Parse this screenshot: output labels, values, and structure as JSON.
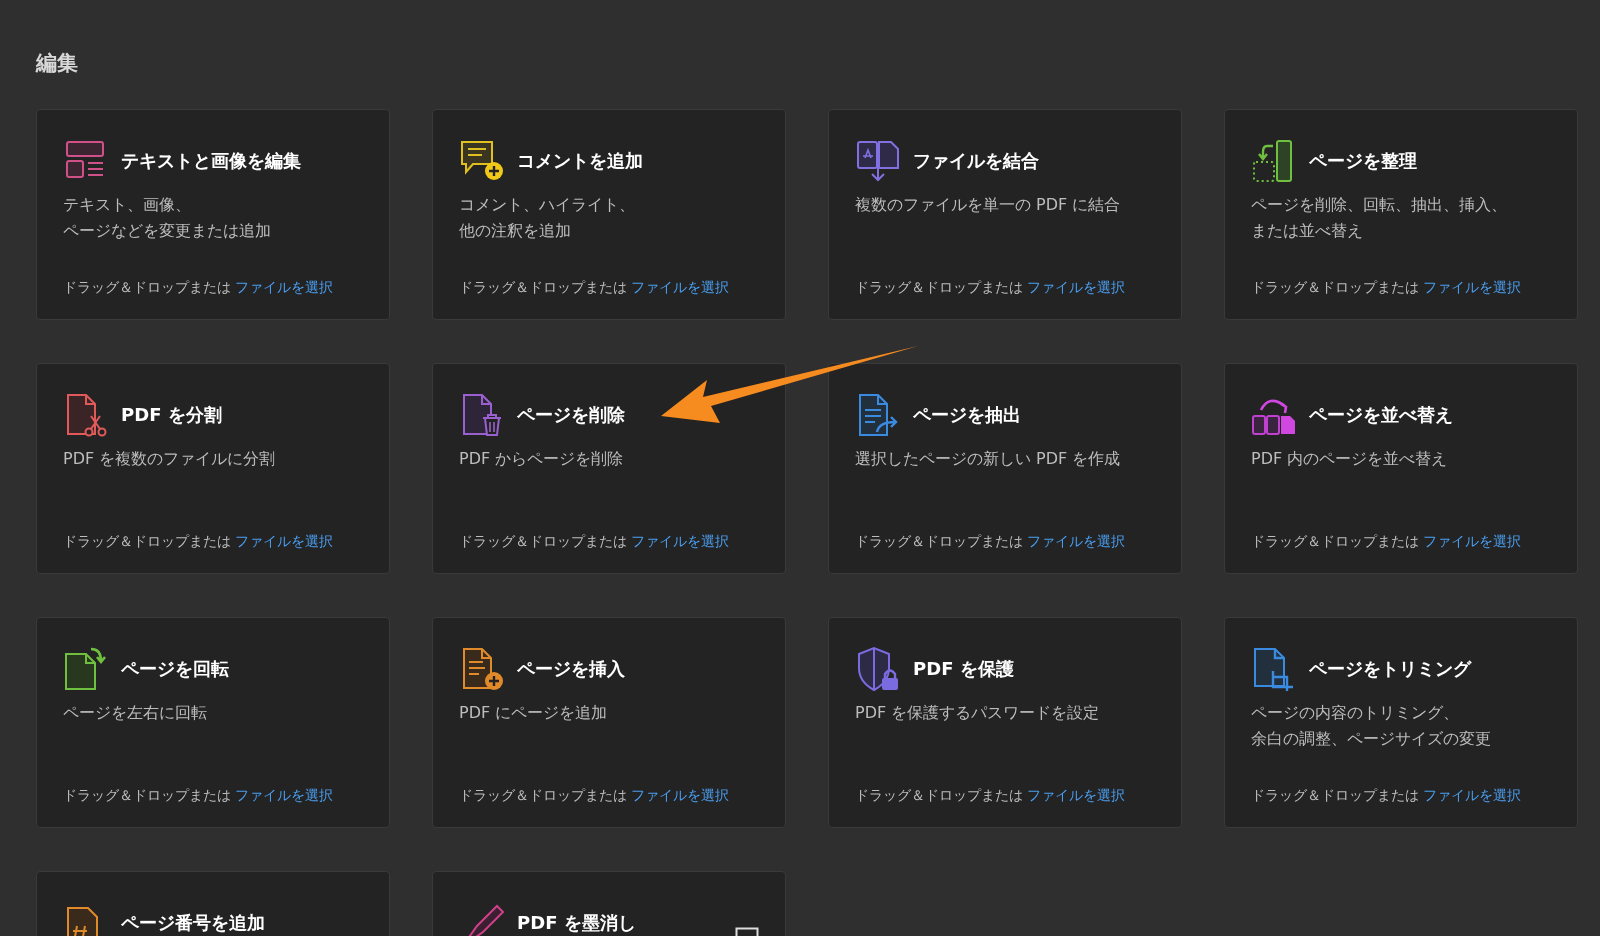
{
  "section_title": "編集",
  "cards": [
    {
      "kind": "edit",
      "title": "テキストと画像を編集",
      "description": [
        "テキスト、画像、",
        "ページなどを変更または追加"
      ],
      "drop_text": "ドラッグ＆ドロップまたは",
      "link": "ファイルを選択",
      "trailing_icon": false
    },
    {
      "kind": "comment",
      "title": "コメントを追加",
      "description": [
        "コメント、ハイライト、",
        "他の注釈を追加"
      ],
      "drop_text": "ドラッグ＆ドロップまたは",
      "link": "ファイルを選択",
      "trailing_icon": false
    },
    {
      "kind": "combine",
      "title": "ファイルを結合",
      "description": [
        "複数のファイルを単一の PDF に結合"
      ],
      "drop_text": "ドラッグ＆ドロップまたは",
      "link": "ファイルを選択",
      "trailing_icon": false
    },
    {
      "kind": "organize",
      "title": "ページを整理",
      "description": [
        "ページを削除、回転、抽出、挿入、",
        "または並べ替え"
      ],
      "drop_text": "ドラッグ＆ドロップまたは",
      "link": "ファイルを選択",
      "trailing_icon": false
    },
    {
      "kind": "split",
      "title": "PDF を分割",
      "description": [
        "PDF を複数のファイルに分割"
      ],
      "drop_text": "ドラッグ＆ドロップまたは",
      "link": "ファイルを選択",
      "trailing_icon": false
    },
    {
      "kind": "delete",
      "title": "ページを削除",
      "description": [
        "PDF からページを削除"
      ],
      "drop_text": "ドラッグ＆ドロップまたは",
      "link": "ファイルを選択",
      "trailing_icon": false
    },
    {
      "kind": "extract",
      "title": "ページを抽出",
      "description": [
        "選択したページの新しい PDF を作成"
      ],
      "drop_text": "ドラッグ＆ドロップまたは",
      "link": "ファイルを選択",
      "trailing_icon": false
    },
    {
      "kind": "reorder",
      "title": "ページを並べ替え",
      "description": [
        "PDF 内のページを並べ替え"
      ],
      "drop_text": "ドラッグ＆ドロップまたは",
      "link": "ファイルを選択",
      "trailing_icon": false
    },
    {
      "kind": "rotate",
      "title": "ページを回転",
      "description": [
        "ページを左右に回転"
      ],
      "drop_text": "ドラッグ＆ドロップまたは",
      "link": "ファイルを選択",
      "trailing_icon": false
    },
    {
      "kind": "insert",
      "title": "ページを挿入",
      "description": [
        "PDF にページを追加"
      ],
      "drop_text": "ドラッグ＆ドロップまたは",
      "link": "ファイルを選択",
      "trailing_icon": false
    },
    {
      "kind": "protect",
      "title": "PDF を保護",
      "description": [
        "PDF を保護するパスワードを設定"
      ],
      "drop_text": "ドラッグ＆ドロップまたは",
      "link": "ファイルを選択",
      "trailing_icon": false
    },
    {
      "kind": "crop",
      "title": "ページをトリミング",
      "description": [
        "ページの内容のトリミング、",
        "余白の調整、ページサイズの変更"
      ],
      "drop_text": "ドラッグ＆ドロップまたは",
      "link": "ファイルを選択",
      "trailing_icon": false
    },
    {
      "kind": "number",
      "title": "ページ番号を追加",
      "trailing_icon": false
    },
    {
      "kind": "redact",
      "title": "PDF を墨消し",
      "trailing_icon": true
    }
  ]
}
